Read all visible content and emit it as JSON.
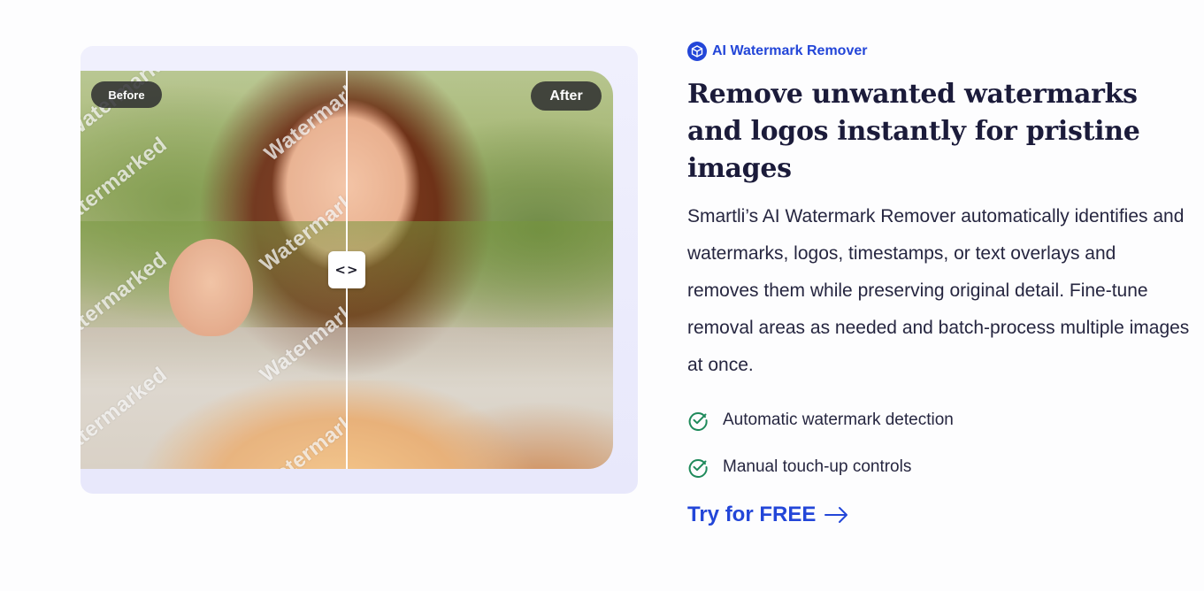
{
  "comparison": {
    "before_label": "Before",
    "after_label": "After",
    "watermark_text": "Watermarked",
    "handle_glyph": "<>"
  },
  "feature_section": {
    "eyebrow": "AI Watermark Remover",
    "eyebrow_icon": "cube-icon",
    "headline": "Remove unwanted watermarks and logos instantly for pristine images",
    "description": "Smartli’s AI Watermark Remover automatically identifies and watermarks, logos, timestamps, or text overlays and removes them while preserving original detail. Fine-tune removal areas as needed and batch-process multiple images at once.",
    "features": [
      {
        "label": "Automatic watermark detection",
        "icon": "check-circle-icon"
      },
      {
        "label": "Manual touch-up controls",
        "icon": "check-circle-icon"
      }
    ],
    "cta_label": "Try for FREE",
    "cta_icon": "arrow-right-icon"
  },
  "colors": {
    "accent": "#2346d8",
    "check": "#1f8a5b",
    "heading": "#1b1b3a",
    "card_bg": "#ececfc"
  }
}
